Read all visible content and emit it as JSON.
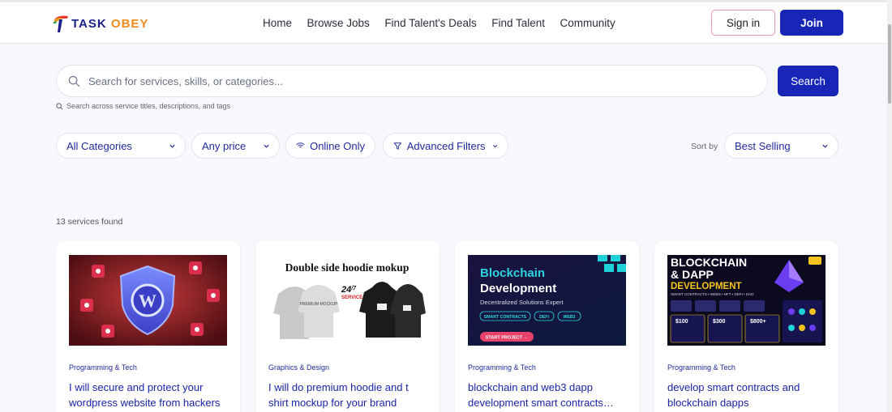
{
  "brand": {
    "name_part1": "TASK",
    "name_part2": "OBEY"
  },
  "nav": {
    "items": [
      {
        "label": "Home"
      },
      {
        "label": "Browse Jobs"
      },
      {
        "label": "Find Talent's Deals"
      },
      {
        "label": "Find Talent"
      },
      {
        "label": "Community"
      }
    ]
  },
  "auth": {
    "signin_label": "Sign in",
    "join_label": "Join"
  },
  "search": {
    "placeholder": "Search for services, skills, or categories...",
    "button_label": "Search",
    "hint": "Search across service titles, descriptions, and tags"
  },
  "filters": {
    "category": "All Categories",
    "price": "Any price",
    "online": "Online Only",
    "advanced": "Advanced Filters",
    "sort_label": "Sort by",
    "sort_value": "Best Selling"
  },
  "results": {
    "count_text": "13 services found"
  },
  "services": [
    {
      "category": "Programming & Tech",
      "title": "I will secure and protect your wordpress website from hackers"
    },
    {
      "category": "Graphics & Design",
      "title": "I will do premium hoodie and t shirt mockup for your brand",
      "thumb": {
        "heading": "Double side hoodie mokup",
        "badge_top": "24",
        "badge_sup": "/7",
        "badge_bottom": "SERVICE",
        "mockup_label": "PREMIUM MOCKUP"
      }
    },
    {
      "category": "Programming & Tech",
      "title": "blockchain and web3 dapp development smart contracts…",
      "thumb": {
        "line1": "Blockchain",
        "line2": "Development",
        "subtitle": "Decentralized Solutions Expert",
        "tags": [
          "SMART CONTRACTS",
          "DEFI",
          "WEB3"
        ],
        "cta": "START PROJECT →"
      }
    },
    {
      "category": "Programming & Tech",
      "title": "develop smart contracts and blockchain dapps",
      "thumb": {
        "line1": "BLOCKCHAIN",
        "line2": "& DAPP",
        "line3": "DEVELOPMENT",
        "strip": "SMART CONTRACTS • WEB3 • NFT • DEFI • DAO",
        "prices": [
          "$100",
          "$300",
          "$800+"
        ]
      }
    }
  ],
  "colors": {
    "primary": "#1826b8",
    "link": "#1a25a6",
    "background": "#f7f8fc"
  }
}
